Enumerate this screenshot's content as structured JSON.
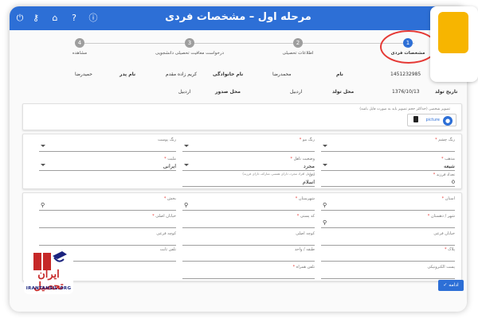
{
  "header": {
    "title": "مرحله اول – مشخصات فردی",
    "icons": [
      "power-icon",
      "key-icon",
      "home-icon",
      "help-icon",
      "info-icon"
    ]
  },
  "steps": [
    {
      "number": "1",
      "label": "مشخصات فردی",
      "active": true
    },
    {
      "number": "2",
      "label": "اطلاعات تحصیلی",
      "active": false
    },
    {
      "number": "3",
      "label": "درخواست معافیت تحصیلی دانشجویی",
      "active": false
    },
    {
      "number": "4",
      "label": "مشاهده",
      "active": false
    }
  ],
  "summary": {
    "national_code_value": "1451232985",
    "name_label": "نام",
    "name_value": "محمدرضا",
    "family_label": "نام خانوادگی",
    "family_value": "کریم زاده مقدم",
    "father_label": "نام پدر",
    "father_value": "حمیدرضا",
    "birth_date_label": "تاریخ تولد",
    "birth_date_value": "1376/10/13",
    "birth_place_label": "محل تولد",
    "birth_place_value": "اردبیل",
    "issue_place_label": "محل صدور",
    "issue_place_value": "اردبیل"
  },
  "photo": {
    "hint": "تصویر شخصی (حداکثر حجم تصویر باید به صورت فایل باشد)",
    "upload_label": "picture"
  },
  "form": {
    "religion_label": "دین",
    "religion_value": "اسلام",
    "marital_label": "وضعیت تاهل",
    "marital_value": "مجرد",
    "marital_hint": "(شامل افراد مجرد، دارای همسر، متارکه، دارای فرزند)",
    "sect_label": "مذهب",
    "sect_value": "شیعه",
    "nationality_label": "ملیت",
    "nationality_value": "ایرانی",
    "color_label": "رنگ چشم",
    "eye_label": "رنگ مو",
    "skin_label": "رنگ پوست",
    "children_label": "تعداد فرزند",
    "children_value": "0",
    "province_label": "استان",
    "city_label": "شهرستان",
    "area_label": "بخش",
    "village_label": "شهر / دهستان",
    "postal_label": "کد پستی",
    "main_street_label": "خیابان اصلی",
    "sub_street_label": "خیابان فرعی",
    "main_alley_label": "کوچه اصلی",
    "sub_alley_label": "کوچه فرعی",
    "plaque_label": "پلاک",
    "unit_label": "طبقه / واحد",
    "phone_label": "تلفن ثابت",
    "email_label": "پست الکترونیکی",
    "mobile_label": "تلفن همراه",
    "submit_label": "ادامه"
  },
  "logo": {
    "text": "ایران تحصیل",
    "site": "IRANTAHSIL.ORG"
  },
  "colors": {
    "primary": "#2d6fd6",
    "annotation": "#e53935",
    "accent": "#f7b500"
  }
}
